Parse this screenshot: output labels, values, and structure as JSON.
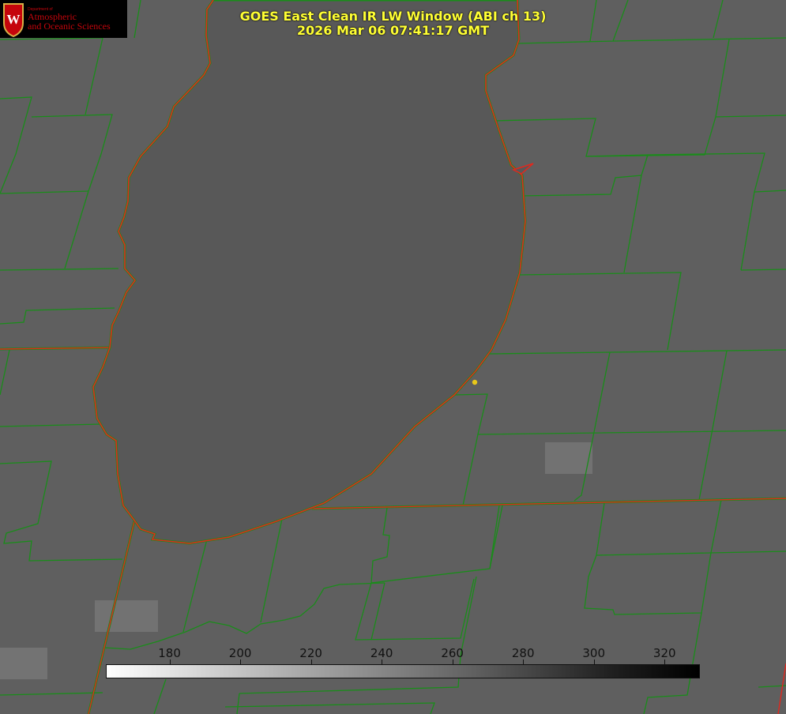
{
  "title": {
    "line1": "GOES East Clean IR LW Window (ABI ch 13)",
    "line2": "2026 Mar 06 07:41:17 GMT"
  },
  "logo": {
    "department": "Department of",
    "name_line1": "Atmospheric",
    "name_line2": "and Oceanic Sciences",
    "icon": "uw-crest-icon"
  },
  "colorbar": {
    "min": 162,
    "max": 330,
    "ticks": [
      180,
      200,
      220,
      240,
      260,
      280,
      300,
      320
    ],
    "ramp": "white-to-black"
  },
  "colors": {
    "background": "#5f5f5f",
    "lake": "#585858",
    "county_lines": "#1a8c1a",
    "state_lines": "#e0281e",
    "title": "#ffff33",
    "marker": "#e8c81a"
  }
}
